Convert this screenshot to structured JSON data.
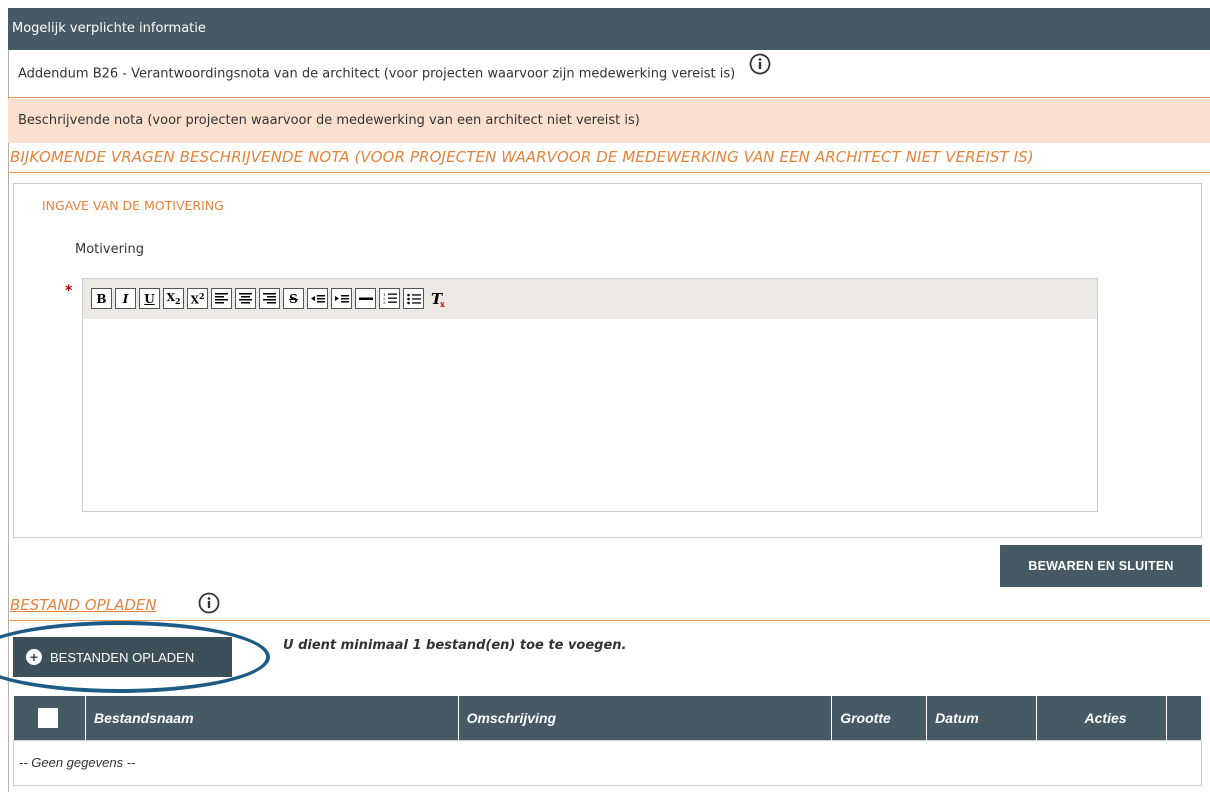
{
  "header": {
    "title": "Mogelijk verplichte informatie"
  },
  "rows": {
    "addendum": "Addendum B26 - Verantwoordingsnota van de architect (voor projecten waarvoor zijn medewerking vereist is)",
    "beschrijvende": "Beschrijvende nota (voor projecten waarvoor de medewerking van een architect niet vereist is)",
    "bijkomende": "BIJKOMENDE VRAGEN BESCHRIJVENDE NOTA (VOOR PROJECTEN WAARVOOR DE MEDEWERKING VAN EEN ARCHITECT NIET VEREIST IS)"
  },
  "form": {
    "section_title": "INGAVE VAN DE MOTIVERING",
    "field_label": "Motivering",
    "required_mark": "*",
    "toolbar": [
      "bold",
      "italic",
      "underline",
      "subscript",
      "superscript",
      "align-left",
      "align-center",
      "align-right",
      "strikethrough",
      "outdent",
      "indent",
      "horizontal-rule",
      "numbered-list",
      "bulleted-list",
      "remove-format"
    ],
    "save_label": "BEWAREN EN SLUITEN"
  },
  "upload": {
    "title": "BESTAND OPLADEN",
    "button_label": "BESTANDEN OPLADEN",
    "hint": "U dient minimaal 1 bestand(en) toe te voegen."
  },
  "table": {
    "columns": [
      "Bestandsnaam",
      "Omschrijving",
      "Grootte",
      "Datum",
      "Acties"
    ],
    "empty": "-- Geen gegevens --"
  },
  "colors": {
    "header": "#455a64",
    "accent": "#e8823a",
    "highlight": "#fbe0cf",
    "ellipse": "#1d5b85"
  }
}
